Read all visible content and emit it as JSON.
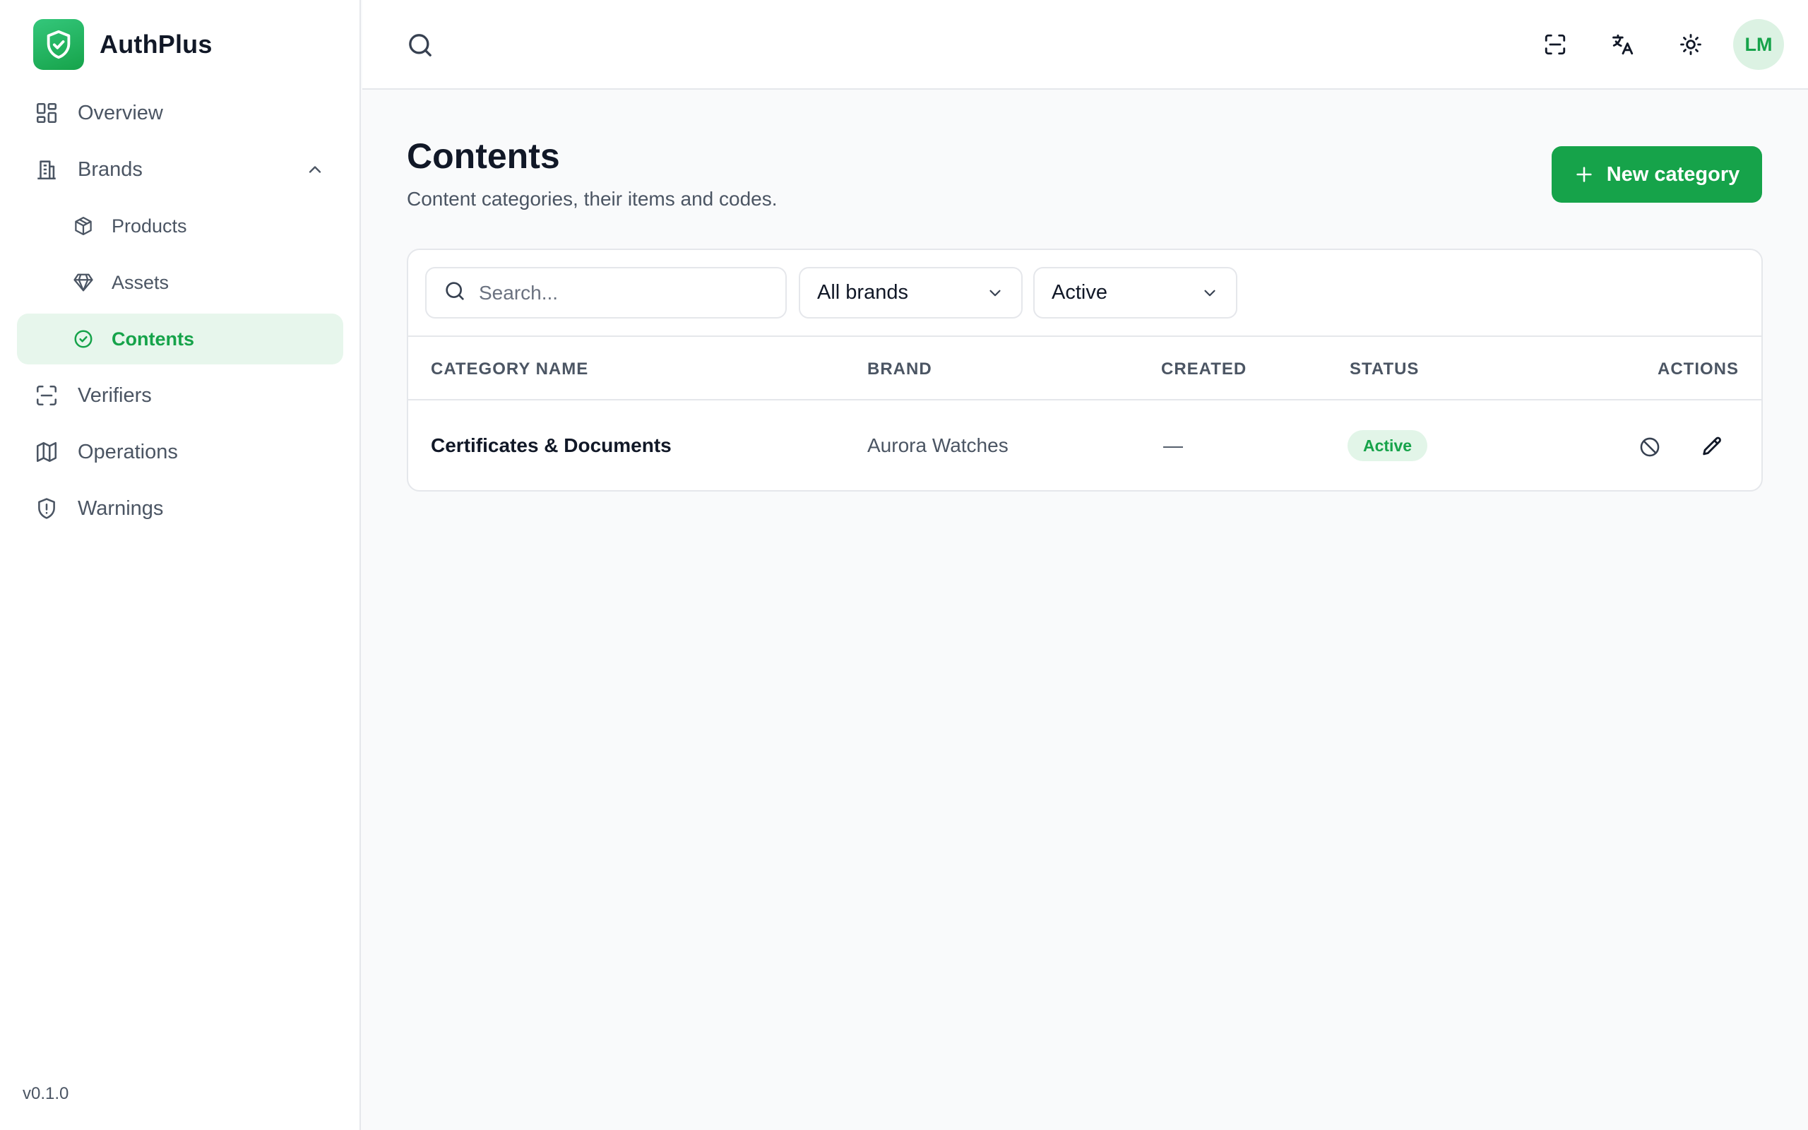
{
  "app": {
    "name": "AuthPlus",
    "version": "v0.1.0"
  },
  "sidebar": {
    "items": [
      {
        "label": "Overview",
        "icon": "dashboard-icon"
      },
      {
        "label": "Brands",
        "icon": "building-icon",
        "expanded": true
      },
      {
        "label": "Products",
        "icon": "box-icon",
        "sub": true
      },
      {
        "label": "Assets",
        "icon": "diamond-icon",
        "sub": true
      },
      {
        "label": "Contents",
        "icon": "check-circle-icon",
        "sub": true,
        "active": true
      },
      {
        "label": "Verifiers",
        "icon": "scan-icon"
      },
      {
        "label": "Operations",
        "icon": "map-icon"
      },
      {
        "label": "Warnings",
        "icon": "shield-alert-icon"
      }
    ]
  },
  "topbar": {
    "avatar_initials": "LM"
  },
  "page": {
    "title": "Contents",
    "subtitle": "Content categories, their items and codes.",
    "new_button": "New category"
  },
  "filters": {
    "search_placeholder": "Search...",
    "brand_select": "All brands",
    "status_select": "Active"
  },
  "table": {
    "columns": [
      "CATEGORY NAME",
      "BRAND",
      "CREATED",
      "STATUS",
      "ACTIONS"
    ],
    "rows": [
      {
        "name": "Certificates & Documents",
        "brand": "Aurora Watches",
        "created": "—",
        "status": "Active"
      }
    ]
  },
  "colors": {
    "accent": "#16a34a",
    "accent_light": "#e7f6ec"
  }
}
